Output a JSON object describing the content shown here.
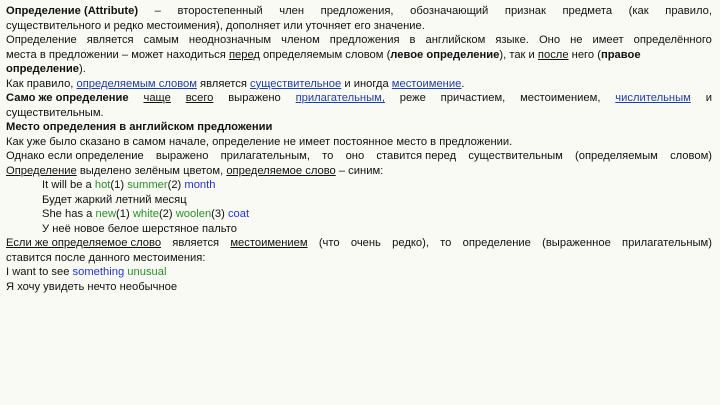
{
  "colors": {
    "background": "#fafaf5",
    "text": "#111111",
    "green": "#2a8f2a",
    "blue": "#2535c8",
    "link": "#1f3fa0"
  },
  "p1": {
    "w": [
      "Определение (Attribute)",
      "–",
      "второстепенный",
      "член",
      "предложения,",
      "обозначающий",
      "признак",
      "предмета",
      "(как",
      "правило,"
    ],
    "l2": "существительного и редко местоимения), дополняет или уточняет его значение."
  },
  "p2": {
    "w": [
      "Определение",
      "является",
      "самым",
      "неоднозначным",
      "членом",
      "предложения",
      "в",
      "английском",
      "языке.",
      "Оно",
      "не",
      "имеет",
      "определённого"
    ],
    "l2_a": "места в предложении – может находиться ",
    "l2_perd": "перед",
    "l2_b": " определяемым словом (",
    "l2_lev": "левое определение",
    "l2_c": "), так и ",
    "l2_posle": "после",
    "l2_d": " него (",
    "l2_prav": "правое",
    "l3_prav": "определение",
    "l3_end": ")."
  },
  "p3": {
    "a": "Как правило, ",
    "link1": "определяемым словом",
    "b": " является ",
    "link2": "существительное",
    "c": " и иногда ",
    "link3": "местоимение",
    "d": "."
  },
  "p4": {
    "s1": "Само же определение",
    "s2": "чаще",
    "s3": "всего",
    "s4": "выражено",
    "s5": "прилагательным,",
    "s6": "реже",
    "s7": "причастием,",
    "s8": "местоимением,",
    "s9": "числительным",
    "s10": "и",
    "l2": "существительным."
  },
  "heading": "Место определения в английском предложении",
  "p5": "Как уже было сказано в самом начале, определение не имеет постоянное место в предложении.",
  "p6": {
    "s1": "Однако если определение",
    "s2": "выражено",
    "s3": "прилагательным,",
    "s4": "то",
    "s5": "оно",
    "s6": "ставится перед",
    "s7": "существительным",
    "s8": "(определяемым",
    "s9": "словом)",
    "l2_a": "Определение",
    "l2_b": " выделено зелёным цветом, ",
    "l2_c": "определяемое слово",
    "l2_d": " – синим:"
  },
  "ex1": {
    "a": "It will be a ",
    "adj": "hot",
    "b": "(1) ",
    "adj2": "summer",
    "c": "(2) ",
    "noun": "month"
  },
  "ex1_ru": "Будет жаркий летний месяц",
  "ex2": {
    "a": "She has a ",
    "adj": "new",
    "b": "(1) ",
    "adj2": "white",
    "c": "(2) ",
    "adj3": "woolen",
    "d": "(3) ",
    "noun": "coat"
  },
  "ex2_ru": "У неё новое белое шерстяное пальто",
  "p7": {
    "s1": "Если же определяемое слово",
    "s2": "является",
    "s3": "местоимением",
    "s4": "(что",
    "s5": "очень",
    "s6": "редко),",
    "s7": "то",
    "s8": "определение",
    "s9": "(выраженное",
    "s10": "прилагательным)",
    "l2": "ставится после данного местоимения:"
  },
  "ex3": {
    "a": "I want to see ",
    "pron": "something",
    "b": " ",
    "adj": "unusual"
  },
  "ex3_ru": "Я хочу увидеть нечто необычное"
}
